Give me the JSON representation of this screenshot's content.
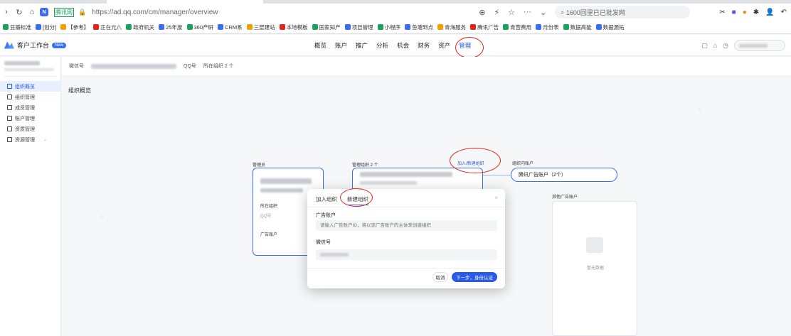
{
  "browser": {
    "url": "https://ad.qq.com/cm/manager/overview",
    "site_label": "腾讯网",
    "search_text": "1600回里已已批发网",
    "bookmarks": [
      "豆瓣标准",
      "[划分]",
      "【参考】",
      "正在元八",
      "政府机关",
      "25年度",
      "360产研",
      "CRM系",
      "三层建站",
      "本地模板",
      "国家知产",
      "项目管理",
      "小程序",
      "鱼塘到点",
      "青海服务",
      "腾讯广告",
      "青营费用",
      "月份表",
      "数据高能",
      "数据源拓"
    ]
  },
  "app": {
    "title": "客户工作台",
    "new_badge": "New",
    "nav": [
      "概览",
      "账户",
      "推广",
      "分析",
      "机会",
      "财务",
      "资产",
      "管理"
    ],
    "active_nav": "管理"
  },
  "sidebar": {
    "items": [
      {
        "label": "组织概览",
        "active": true
      },
      {
        "label": "组织管理",
        "active": false
      },
      {
        "label": "成员管理",
        "active": false
      },
      {
        "label": "账户管理",
        "active": false
      },
      {
        "label": "资质管理",
        "active": false
      },
      {
        "label": "资源管理",
        "active": false
      }
    ]
  },
  "subheader": {
    "wechat_label": "微信号",
    "qq_label": "QQ号",
    "org_count_label": "所在组织 2 个"
  },
  "main": {
    "section_title": "组织概览",
    "owner_label": "管理员",
    "current_org_label": "管理组织 2 个",
    "join_link": "加入/新建组织",
    "org_accounts_label": "组织内账户",
    "tencent_account": "腾讯广告账户（2个）",
    "other_accounts_label": "其他广告账户",
    "empty_text": "暂无数据",
    "card_fields": [
      "所在组织",
      "广告账户"
    ]
  },
  "modal": {
    "tabs": [
      "加入组织",
      "新建组织"
    ],
    "active_tab": "新建组织",
    "field1_label": "广告账户",
    "field1_placeholder": "请输入广告账户ID，将以该广告账户的主体来创建组织",
    "field2_label": "微信号",
    "cancel_label": "取消",
    "next_label": "下一步，身份认证"
  }
}
